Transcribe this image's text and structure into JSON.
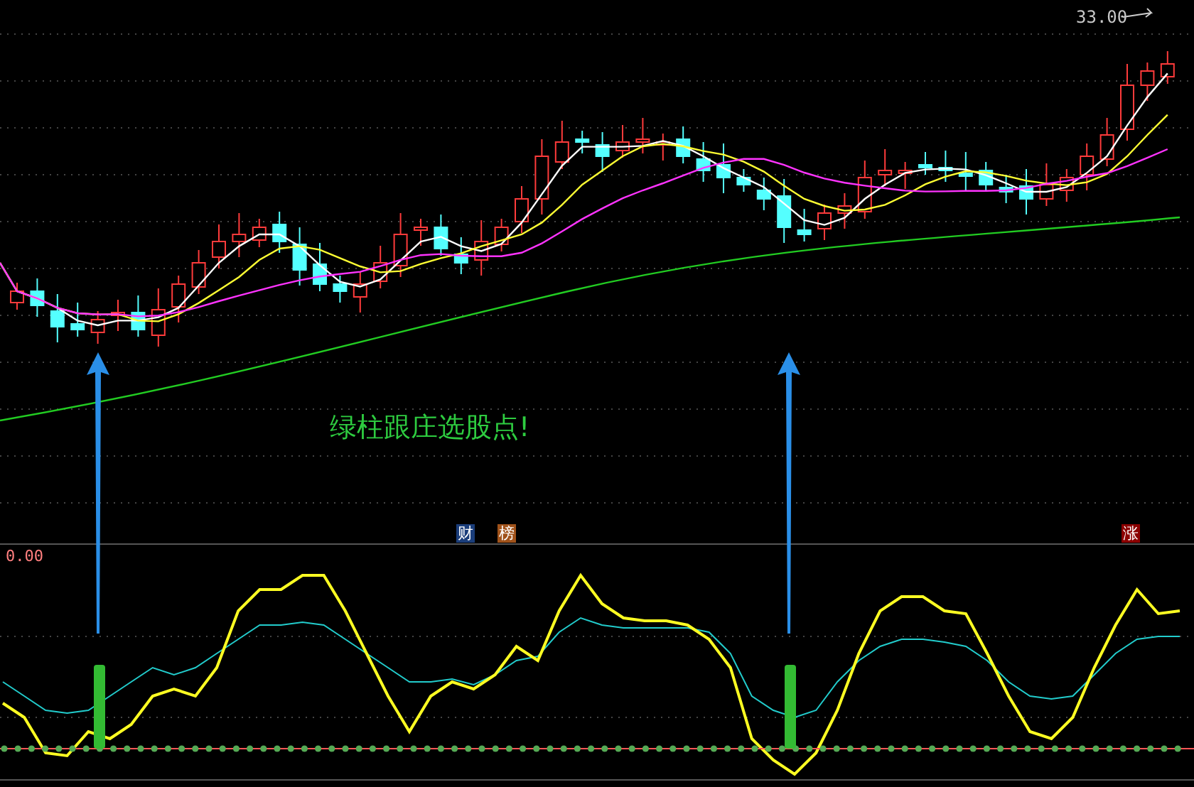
{
  "price_panel": {
    "high_label": "33.00",
    "annotation": "绿柱跟庄选股点!"
  },
  "event_tags": [
    {
      "label": "财",
      "color": "#1a3d7a"
    },
    {
      "label": "榜",
      "color": "#a0521a"
    },
    {
      "label": "涨",
      "color": "#8b0000"
    }
  ],
  "indicator_panel": {
    "zero_label": "0.00"
  }
}
